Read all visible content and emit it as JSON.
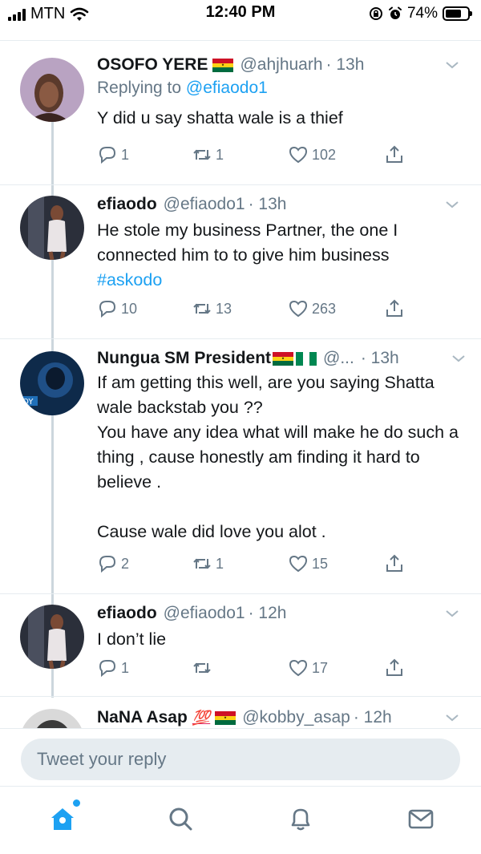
{
  "status_bar": {
    "carrier": "MTN",
    "time": "12:40 PM",
    "battery": "74%",
    "battery_level": 0.74
  },
  "tweets": [
    {
      "name": "OSOFO YERE",
      "flags": [
        "ghana"
      ],
      "handle": "@ahjhuarh",
      "time": "· 13h",
      "replying_prefix": "Replying to",
      "replying_to": "@efiaodo1",
      "text": "Y did u say shatta wale is a thief",
      "replies": "1",
      "retweets": "1",
      "likes": "102"
    },
    {
      "name": "efiaodo",
      "handle": "@efiaodo1",
      "time": "· 13h",
      "text": "He stole my business Partner, the one I connected him to to give him business",
      "hashtag": "#askodo",
      "replies": "10",
      "retweets": "13",
      "likes": "263"
    },
    {
      "name": "Nungua SM President",
      "flags": [
        "ghana",
        "nigeria"
      ],
      "handle": "@...",
      "time": "· 13h",
      "text": "If am getting this well, are you saying Shatta wale backstab you ??\nYou have any idea what will make he do such a thing , cause honestly am finding it hard to believe .\n\nCause wale did love you alot .",
      "replies": "2",
      "retweets": "1",
      "likes": "15"
    },
    {
      "name": "efiaodo",
      "handle": "@efiaodo1",
      "time": "· 12h",
      "text": "I don’t lie",
      "replies": "1",
      "retweets": "",
      "likes": "17"
    },
    {
      "name": "NaNA Asap",
      "emoji": "💯",
      "flags": [
        "ghana"
      ],
      "handle": "@kobby_asap",
      "time": "· 12h"
    }
  ],
  "reply_box": {
    "placeholder": "Tweet your reply"
  },
  "tab_bar": {
    "items": [
      "home-icon",
      "search-icon",
      "notifications-icon",
      "messages-icon"
    ],
    "active": "home-icon"
  },
  "colors": {
    "accent": "#1da1f2",
    "secondary_text": "#657786",
    "divider": "#e6ecf0",
    "thread_line": "#ccd6dd",
    "ghana_red": "#ce1126",
    "ghana_gold": "#fcd116",
    "ghana_green": "#006b3f",
    "nigeria_green": "#008751"
  }
}
